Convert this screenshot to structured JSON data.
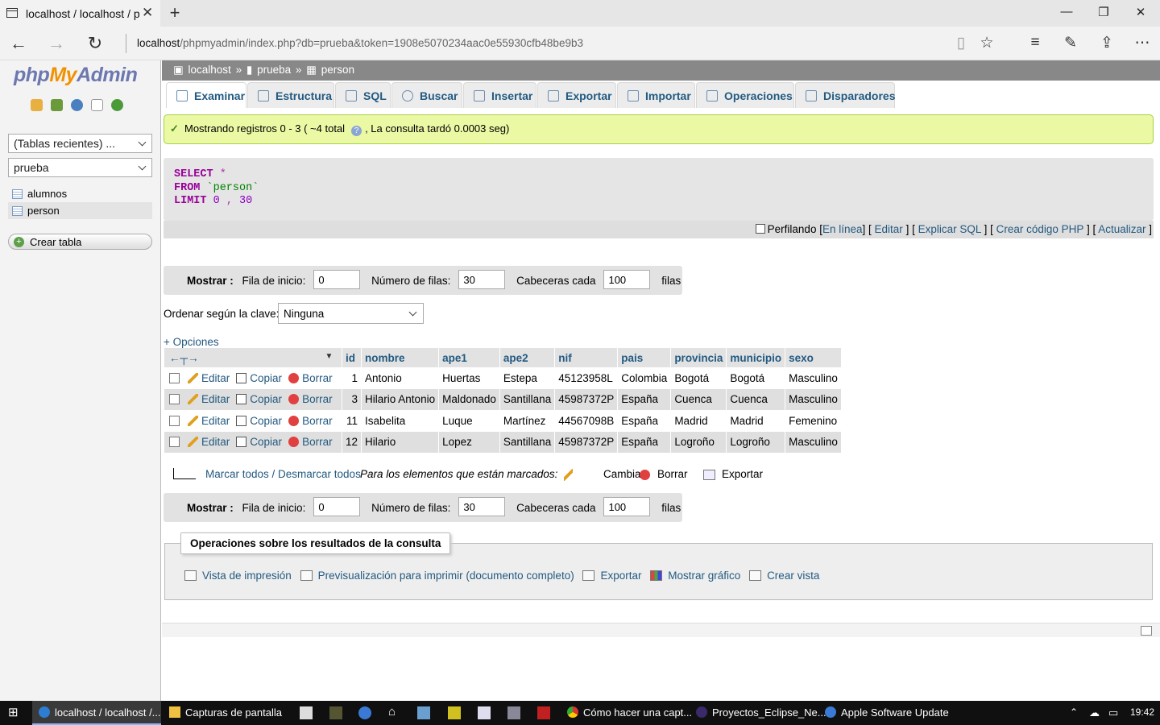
{
  "browser": {
    "tab_title": "localhost / localhost / p",
    "url_host": "localhost",
    "url_path": "/phpmyadmin/index.php?db=prueba&token=1908e5070234aac0e55930cfb48be9b3"
  },
  "sidebar": {
    "logo_php": "php",
    "logo_my": "My",
    "logo_admin": "Admin",
    "recent_select": "(Tablas recientes) ...",
    "db_select": "prueba",
    "tables": [
      "alumnos",
      "person"
    ],
    "create_table": "Crear tabla"
  },
  "breadcrumb": {
    "server": "localhost",
    "sep1": "»",
    "db": "prueba",
    "sep2": "»",
    "table": "person"
  },
  "tabs": [
    "Examinar",
    "Estructura",
    "SQL",
    "Buscar",
    "Insertar",
    "Exportar",
    "Importar",
    "Operaciones",
    "Disparadores"
  ],
  "success": {
    "text1": "Mostrando registros 0 - 3 ( ~4 total",
    "text2": ", La consulta tardó 0.0003 seg)"
  },
  "sql": {
    "select": "SELECT",
    "star": " *",
    "from": "FROM",
    "table": " `person`",
    "limit": "LIMIT",
    "n0": " 0",
    "comma": " , ",
    "n30": "30"
  },
  "profiling": {
    "label": "Perfilando",
    "links": [
      "En línea",
      "Editar",
      "Explicar SQL",
      "Crear código PHP",
      "Actualizar"
    ]
  },
  "nav": {
    "mostrar": "Mostrar :",
    "fila_inicio": "Fila de inicio:",
    "fila_inicio_val": "0",
    "num_filas": "Número de filas:",
    "num_filas_val": "30",
    "cabeceras": "Cabeceras cada",
    "cabeceras_val": "100",
    "filas": "filas"
  },
  "sort": {
    "label": "Ordenar según la clave:",
    "value": "Ninguna"
  },
  "opciones": "+ Opciones",
  "table": {
    "columns": [
      "id",
      "nombre",
      "ape1",
      "ape2",
      "nif",
      "pais",
      "provincia",
      "municipio",
      "sexo"
    ],
    "actions": {
      "edit": "Editar",
      "copy": "Copiar",
      "delete": "Borrar"
    },
    "rows": [
      [
        "1",
        "Antonio",
        "Huertas",
        "Estepa",
        "45123958L",
        "Colombia",
        "Bogotá",
        "Bogotá",
        "Masculino"
      ],
      [
        "3",
        "Hilario Antonio",
        "Maldonado",
        "Santillana",
        "45987372P",
        "España",
        "Cuenca",
        "Cuenca",
        "Masculino"
      ],
      [
        "11",
        "Isabelita",
        "Luque",
        "Martínez",
        "44567098B",
        "España",
        "Madrid",
        "Madrid",
        "Femenino"
      ],
      [
        "12",
        "Hilario",
        "Lopez",
        "Santillana",
        "45987372P",
        "España",
        "Logroño",
        "Logroño",
        "Masculino"
      ]
    ]
  },
  "bulk": {
    "marcar": "Marcar todos / Desmarcar todos",
    "para": "Para los elementos que están marcados:",
    "cambiar": "Cambiar",
    "borrar": "Borrar",
    "exportar": "Exportar"
  },
  "ops": {
    "legend": "Operaciones sobre los resultados de la consulta",
    "links": [
      "Vista de impresión",
      "Previsualización para imprimir (documento completo)",
      "Exportar",
      "Mostrar gráfico",
      "Crear vista"
    ]
  },
  "taskbar": {
    "items": [
      "localhost / localhost /...",
      "Capturas de pantalla",
      "Cómo hacer una capt...",
      "Proyectos_Eclipse_Ne...",
      "Apple Software Update"
    ],
    "time": "19:42"
  },
  "colors": {
    "link": "#235a81",
    "success_bg": "#ebf8a4",
    "logo_orange": "#f29100"
  }
}
